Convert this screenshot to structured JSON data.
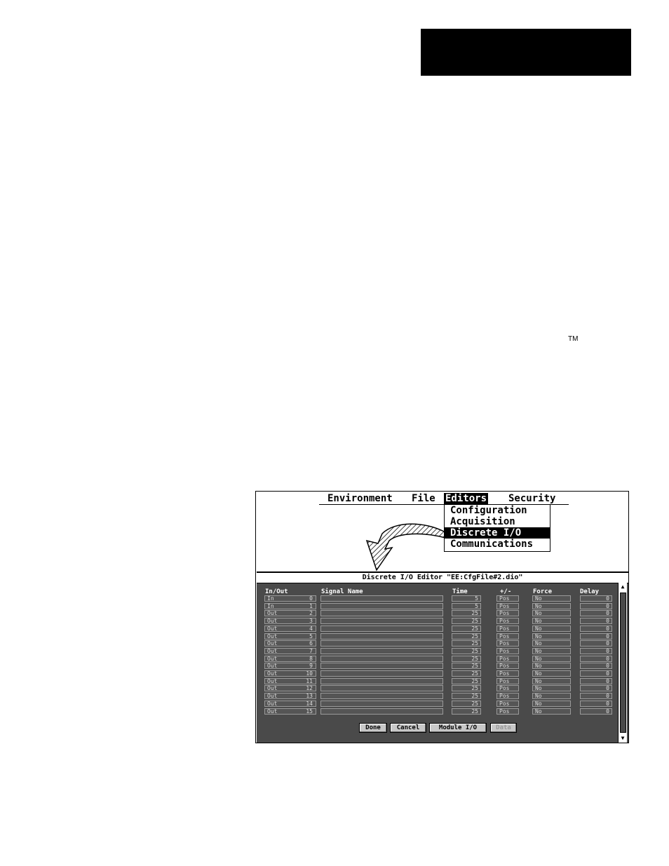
{
  "trademark": "TM",
  "menubar": {
    "items": [
      "Environment",
      "File",
      "Editors",
      "Security"
    ]
  },
  "dropdown": {
    "items": [
      "Configuration",
      "Acquisition",
      "Discrete I/O",
      "Communications"
    ]
  },
  "editor": {
    "title": "Discrete I/O Editor \"EE:CfgFile#2.dio\"",
    "columns": [
      "In/Out",
      "Signal Name",
      "Time",
      "+/-",
      "Force",
      "Delay"
    ],
    "rows": [
      {
        "io": "In",
        "num": "0",
        "signal": "",
        "time": "5",
        "sign": "Pos",
        "force": "No",
        "delay": "0"
      },
      {
        "io": "In",
        "num": "1",
        "signal": "",
        "time": "5",
        "sign": "Pos",
        "force": "No",
        "delay": "0"
      },
      {
        "io": "Out",
        "num": "2",
        "signal": "",
        "time": "25",
        "sign": "Pos",
        "force": "No",
        "delay": "0"
      },
      {
        "io": "Out",
        "num": "3",
        "signal": "",
        "time": "25",
        "sign": "Pos",
        "force": "No",
        "delay": "0"
      },
      {
        "io": "Out",
        "num": "4",
        "signal": "",
        "time": "25",
        "sign": "Pos",
        "force": "No",
        "delay": "0"
      },
      {
        "io": "Out",
        "num": "5",
        "signal": "",
        "time": "25",
        "sign": "Pos",
        "force": "No",
        "delay": "0"
      },
      {
        "io": "Out",
        "num": "6",
        "signal": "",
        "time": "25",
        "sign": "Pos",
        "force": "No",
        "delay": "0"
      },
      {
        "io": "Out",
        "num": "7",
        "signal": "",
        "time": "25",
        "sign": "Pos",
        "force": "No",
        "delay": "0"
      },
      {
        "io": "Out",
        "num": "8",
        "signal": "",
        "time": "25",
        "sign": "Pos",
        "force": "No",
        "delay": "0"
      },
      {
        "io": "Out",
        "num": "9",
        "signal": "",
        "time": "25",
        "sign": "Pos",
        "force": "No",
        "delay": "0"
      },
      {
        "io": "Out",
        "num": "10",
        "signal": "",
        "time": "25",
        "sign": "Pos",
        "force": "No",
        "delay": "0"
      },
      {
        "io": "Out",
        "num": "11",
        "signal": "",
        "time": "25",
        "sign": "Pos",
        "force": "No",
        "delay": "0"
      },
      {
        "io": "Out",
        "num": "12",
        "signal": "",
        "time": "25",
        "sign": "Pos",
        "force": "No",
        "delay": "0"
      },
      {
        "io": "Out",
        "num": "13",
        "signal": "",
        "time": "25",
        "sign": "Pos",
        "force": "No",
        "delay": "0"
      },
      {
        "io": "Out",
        "num": "14",
        "signal": "",
        "time": "25",
        "sign": "Pos",
        "force": "No",
        "delay": "0"
      },
      {
        "io": "Out",
        "num": "15",
        "signal": "",
        "time": "25",
        "sign": "Pos",
        "force": "No",
        "delay": "0"
      }
    ],
    "buttons": {
      "done": "Done",
      "cancel": "Cancel",
      "module_io": "Module I/O",
      "data": "Data"
    }
  },
  "icons": {
    "scroll_up": "▲",
    "scroll_down": "▼"
  }
}
